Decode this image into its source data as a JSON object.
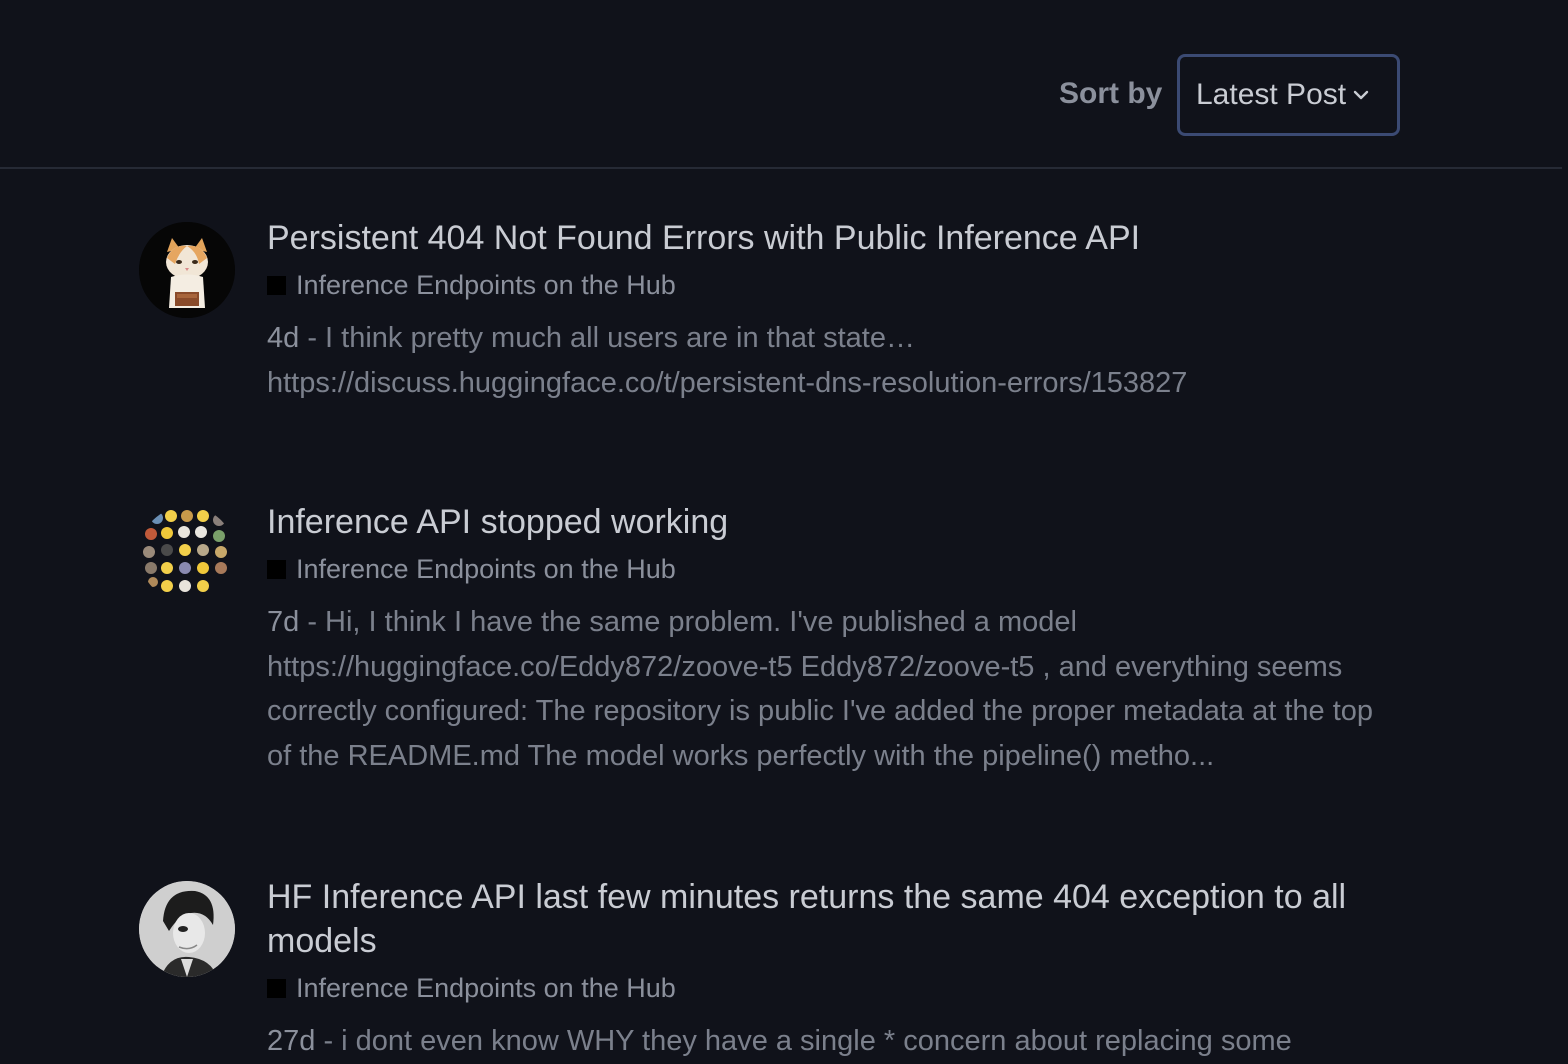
{
  "sort": {
    "label": "Sort by",
    "value": "Latest Post"
  },
  "topics": [
    {
      "title": "Persistent 404 Not Found Errors with Public Inference API",
      "category": "Inference Endpoints on the Hub",
      "age": "4d",
      "separator": " - ",
      "excerpt": "I think pretty much all users are in that state… https://discuss.huggingface.co/t/persistent-dns-resolution-errors/153827",
      "avatar": "cat-avatar"
    },
    {
      "title": "Inference API stopped working",
      "category": "Inference Endpoints on the Hub",
      "age": "7d",
      "separator": " - ",
      "excerpt": "Hi, I think I have the same problem. I've published a model https://huggingface.co/Eddy872/zoove-t5 Eddy872/zoove-t5 , and everything seems correctly configured: The repository is public I've added the proper metadata at the top of the README.md The model works perfectly with the pipeline() metho...",
      "avatar": "emoji-grid-avatar"
    },
    {
      "title": "HF Inference API last few minutes returns the same 404 exception to all models",
      "category": "Inference Endpoints on the Hub",
      "age": "27d",
      "separator": " - ",
      "excerpt": "i dont even know WHY they have a single * concern about replacing some",
      "avatar": "portrait-avatar"
    }
  ]
}
